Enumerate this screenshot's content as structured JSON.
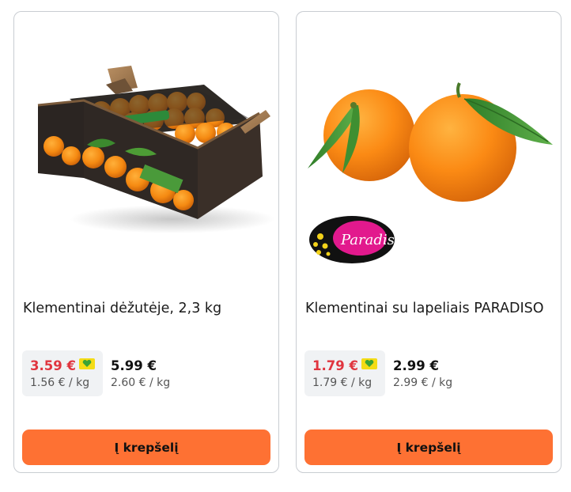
{
  "products": [
    {
      "title": "Klementinai dėžutėje, 2,3 kg",
      "image_icon": "clementine-box-image",
      "promo_price": "3.59 €",
      "promo_unit_price": "1.56 € / kg",
      "loyalty_badge_icon": "loyalty-card-icon",
      "regular_price": "5.99 €",
      "regular_unit_price": "2.60 € / kg",
      "button_label": "Į krepšelį"
    },
    {
      "title": "Klementinai su lapeliais PARADISO",
      "image_icon": "clementines-with-leaves-image",
      "brand_logo_text": "Paradiso",
      "brand_logo_icon": "paradiso-logo",
      "promo_price": "1.79 €",
      "promo_unit_price": "1.79 € / kg",
      "loyalty_badge_icon": "loyalty-card-icon",
      "regular_price": "2.99 €",
      "regular_unit_price": "2.99 € / kg",
      "button_label": "Į krepšelį"
    }
  ],
  "colors": {
    "promo_price": "#e0353f",
    "button_bg": "#fe7133",
    "promo_bg": "#f0f2f4",
    "badge_yellow": "#f4dc16",
    "badge_heart": "#3aa335"
  }
}
